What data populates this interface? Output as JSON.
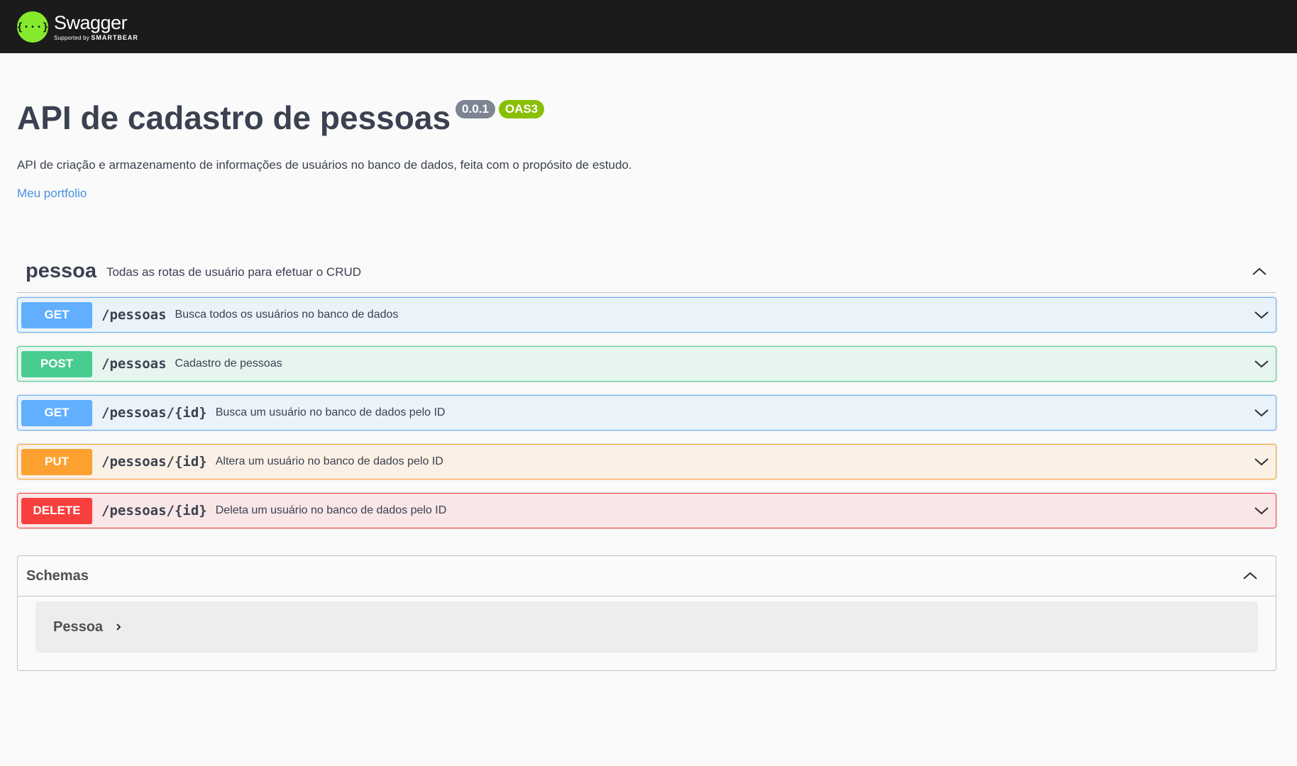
{
  "topbar": {
    "logo_glyph": "{···}",
    "logo_title": "Swagger",
    "logo_sub_prefix": "Supported by ",
    "logo_sub_brand": "SMARTBEAR"
  },
  "info": {
    "title": "API de cadastro de pessoas",
    "version": "0.0.1",
    "oas": "OAS3",
    "description": "API de criação e armazenamento de informações de usuários no banco de dados, feita com o propósito de estudo.",
    "link_label": "Meu portfolio"
  },
  "tag": {
    "name": "pessoa",
    "description": "Todas as rotas de usuário para efetuar o CRUD"
  },
  "operations": [
    {
      "method": "GET",
      "path": "/pessoas",
      "summary": "Busca todos os usuários no banco de dados"
    },
    {
      "method": "POST",
      "path": "/pessoas",
      "summary": "Cadastro de pessoas"
    },
    {
      "method": "GET",
      "path": "/pessoas/{id}",
      "summary": "Busca um usuário no banco de dados pelo ID"
    },
    {
      "method": "PUT",
      "path": "/pessoas/{id}",
      "summary": "Altera um usuário no banco de dados pelo ID"
    },
    {
      "method": "DELETE",
      "path": "/pessoas/{id}",
      "summary": "Deleta um usuário no banco de dados pelo ID"
    }
  ],
  "schemas": {
    "title": "Schemas",
    "models": [
      "Pessoa"
    ]
  },
  "colors": {
    "topbar": "#1b1b1b",
    "logo_green": "#85ea2d",
    "get": "#61affe",
    "post": "#49cc90",
    "put": "#fca130",
    "delete": "#f93e3e",
    "version_badge": "#7d8492",
    "oas_badge": "#89bf04",
    "link": "#4990e2"
  }
}
